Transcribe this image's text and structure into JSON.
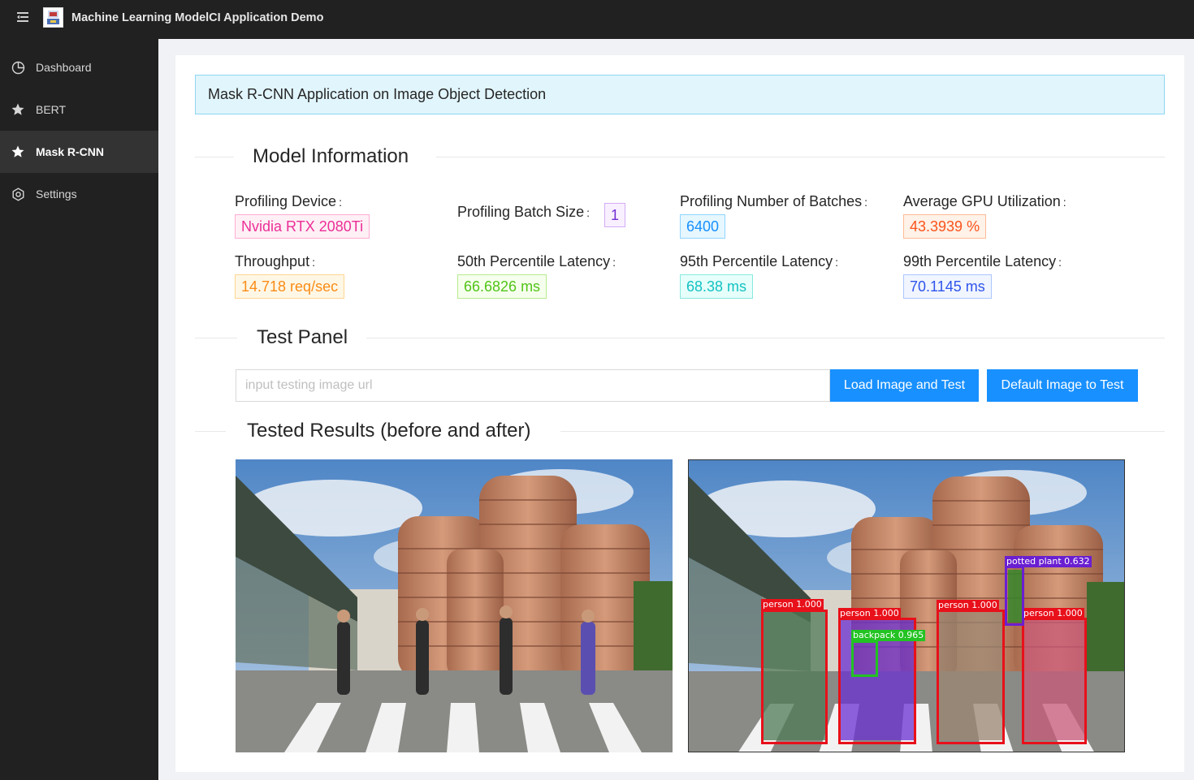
{
  "header": {
    "title": "Machine Learning ModelCI Application Demo",
    "menu_icon": "menu-fold-icon",
    "logo_icon": "app-logo"
  },
  "sidebar": {
    "items": [
      {
        "label": "Dashboard",
        "icon": "pie-chart-icon",
        "active": false
      },
      {
        "label": "BERT",
        "icon": "star-icon",
        "active": false
      },
      {
        "label": "Mask R-CNN",
        "icon": "star-icon",
        "active": true
      },
      {
        "label": "Settings",
        "icon": "settings-icon",
        "active": false
      }
    ]
  },
  "main": {
    "alert": "Mask R-CNN Application on Image Object Detection",
    "model_info": {
      "title": "Model Information",
      "profiling_device": {
        "label": "Profiling Device",
        "value": "Nvidia RTX 2080Ti",
        "color": "#eb2f96"
      },
      "batch_size": {
        "label": "Profiling Batch Size",
        "value": "1",
        "color": "#722ed1"
      },
      "num_batches": {
        "label": "Profiling Number of Batches",
        "value": "6400",
        "color": "#1890ff"
      },
      "gpu_util": {
        "label": "Average GPU Utilization",
        "value": "43.3939 %",
        "color": "#fa541c"
      },
      "throughput": {
        "label": "Throughput",
        "value": "14.718 req/sec",
        "color": "#fa8c16"
      },
      "p50": {
        "label": "50th Percentile Latency",
        "value": "66.6826 ms",
        "color": "#52c41a"
      },
      "p95": {
        "label": "95th Percentile Latency",
        "value": "68.38 ms",
        "color": "#13c2c2"
      },
      "p99": {
        "label": "99th Percentile Latency",
        "value": "70.1145 ms",
        "color": "#2f54eb"
      }
    },
    "test_panel": {
      "title": "Test Panel",
      "input_placeholder": "input testing image url",
      "input_value": "",
      "load_button": "Load Image and Test",
      "default_button": "Default Image to Test"
    },
    "results": {
      "title": "Tested Results (before and after)",
      "detections": [
        {
          "label": "person 1.000",
          "color": "#e8101a"
        },
        {
          "label": "person 1.000",
          "color": "#e8101a"
        },
        {
          "label": "person 1.000",
          "color": "#e8101a"
        },
        {
          "label": "person 1.000",
          "color": "#e8101a"
        },
        {
          "label": "backpack 0.965",
          "color": "#22c322"
        },
        {
          "label": "potted plant 0.632",
          "color": "#6a1fd1"
        }
      ]
    }
  }
}
